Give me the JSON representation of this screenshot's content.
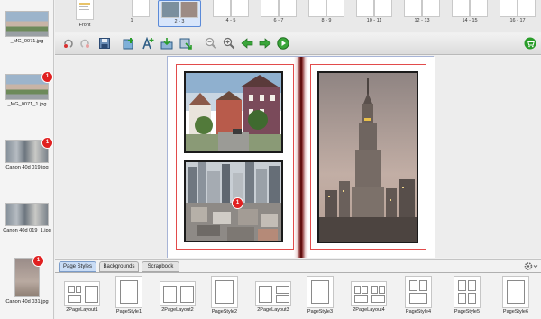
{
  "sidebar": {
    "items": [
      {
        "label": "_MG_0071.jpg",
        "badge": ""
      },
      {
        "label": "_MG_0071_1.jpg",
        "badge": "1"
      },
      {
        "label": "Canon 40d 019.jpg",
        "badge": "1"
      },
      {
        "label": "Canon 40d 019_1.jpg",
        "badge": ""
      },
      {
        "label": "Canon 40d 031.jpg",
        "badge": "1"
      }
    ]
  },
  "filmstrip": {
    "pages": [
      "Front",
      "1",
      "2 - 3",
      "4 - 5",
      "6 - 7",
      "8 - 9",
      "10 - 11",
      "12 - 13",
      "14 - 15",
      "16 - 17"
    ],
    "selected": "2 - 3"
  },
  "toolbar": {
    "buttons": [
      "undo-icon",
      "redo-icon",
      "save-icon",
      "add-photo-icon",
      "add-text-icon",
      "import-icon",
      "export-icon",
      "zoom-out-icon",
      "zoom-in-icon",
      "prev-page-icon",
      "next-page-icon",
      "play-icon",
      "cart-icon"
    ]
  },
  "canvas": {
    "photos": [
      "houses-street-photo",
      "city-rooftops-photo",
      "empire-state-photo"
    ],
    "photo_badge": "1"
  },
  "bottom": {
    "tabs": [
      "Page Styles",
      "Backgrounds",
      "Scrapbook"
    ],
    "active_tab": "Page Styles",
    "styles": [
      {
        "label": "2PageLayout1"
      },
      {
        "label": "PageStyle1"
      },
      {
        "label": "2PageLayout2"
      },
      {
        "label": "PageStyle2"
      },
      {
        "label": "2PageLayout3"
      },
      {
        "label": "PageStyle3"
      },
      {
        "label": "2PageLayout4"
      },
      {
        "label": "PageStyle4"
      },
      {
        "label": "PageStyle5"
      },
      {
        "label": "PageStyle6"
      }
    ]
  },
  "colors": {
    "accent": "#5b8ad8",
    "guide": "#e24b4b",
    "badge": "#e02020",
    "cart": "#2a9d2a"
  }
}
